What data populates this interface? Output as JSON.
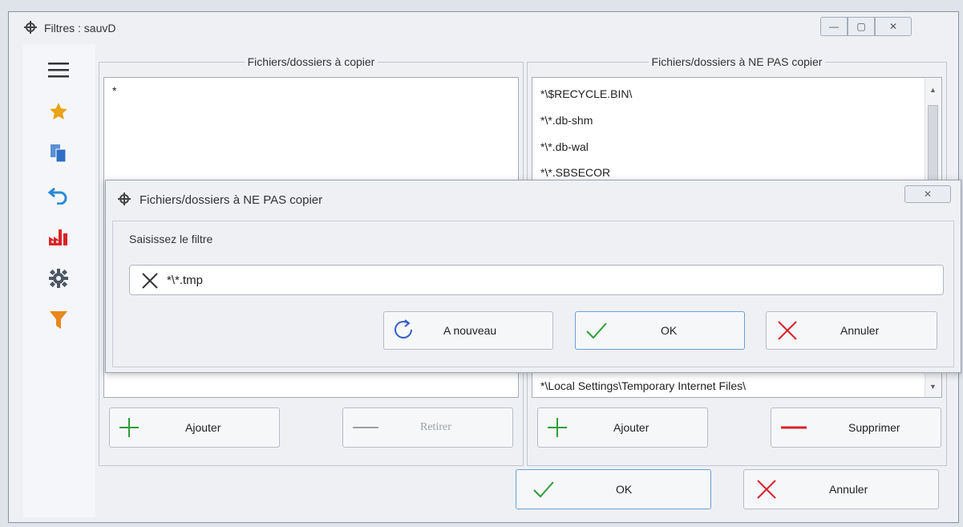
{
  "window": {
    "title": "Filtres : sauvD",
    "controls": {
      "minimize": "—",
      "maximize": "▢",
      "close": "✕"
    }
  },
  "sidebar": {
    "icons": [
      "menu-icon",
      "star-icon",
      "copy-icon",
      "undo-icon",
      "factory-icon",
      "gear-icon",
      "filter-icon"
    ]
  },
  "left_panel": {
    "title": "Fichiers/dossiers à copier",
    "items": [
      "*"
    ],
    "add_label": "Ajouter",
    "remove_label": "Retirer"
  },
  "right_panel": {
    "title": "Fichiers/dossiers à NE PAS copier",
    "items": [
      "*\\$RECYCLE.BIN\\",
      "*\\*.db-shm",
      "*\\*.db-wal",
      "*\\*.SBSECOR"
    ],
    "last_item": "*\\Local Settings\\Temporary Internet Files\\",
    "add_label": "Ajouter",
    "delete_label": "Supprimer"
  },
  "footer": {
    "ok_label": "OK",
    "cancel_label": "Annuler"
  },
  "dialog": {
    "title": "Fichiers/dossiers à NE PAS copier",
    "close": "✕",
    "prompt": "Saisissez le filtre",
    "input_value": "*\\*.tmp",
    "again_label": "A nouveau",
    "ok_label": "OK",
    "cancel_label": "Annuler"
  },
  "colors": {
    "green": "#2e9e3a",
    "red": "#d8232a",
    "blue": "#3560c9",
    "focus": "#6a9fd8"
  }
}
